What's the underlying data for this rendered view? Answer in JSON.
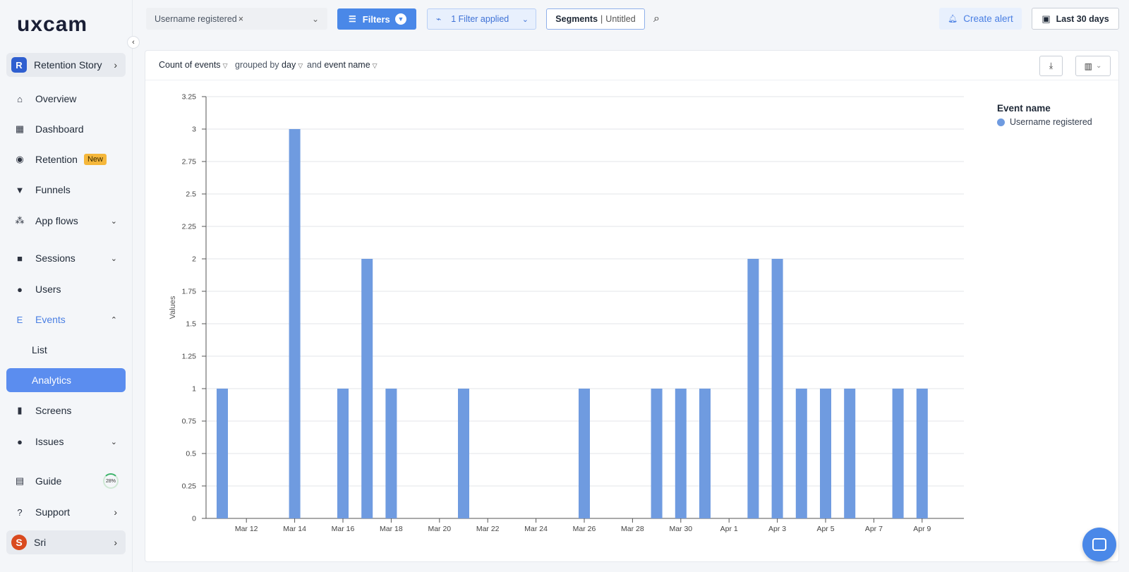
{
  "app": {
    "logo": "uxcam"
  },
  "sidebar": {
    "project": {
      "badge": "R",
      "name": "Retention Story"
    },
    "items": [
      {
        "label": "Overview",
        "icon": "home-icon"
      },
      {
        "label": "Dashboard",
        "icon": "dashboard-icon"
      },
      {
        "label": "Retention",
        "icon": "retention-icon",
        "badge": "New"
      },
      {
        "label": "Funnels",
        "icon": "funnel-icon"
      },
      {
        "label": "App flows",
        "icon": "flows-icon"
      },
      {
        "label": "Sessions",
        "icon": "video-icon"
      },
      {
        "label": "Users",
        "icon": "users-icon"
      },
      {
        "label": "Events",
        "icon": "events-icon"
      },
      {
        "label": "List"
      },
      {
        "label": "Analytics"
      },
      {
        "label": "Screens",
        "icon": "screen-icon"
      },
      {
        "label": "Issues",
        "icon": "alert-icon"
      },
      {
        "label": "Guide",
        "icon": "guide-icon",
        "progress": "28%"
      },
      {
        "label": "Support",
        "icon": "support-icon"
      }
    ],
    "user": {
      "initial": "S",
      "name": "Sri"
    }
  },
  "toolbar": {
    "event_select": "Username registered",
    "filters_label": "Filters",
    "filters_applied": "1 Filter applied",
    "segments_label": "Segments",
    "segments_value": "Untitled",
    "create_alert": "Create alert",
    "date_range": "Last 30 days"
  },
  "query": {
    "metric": "Count of events",
    "grouped_prefix": "grouped by",
    "grouped_value": "day",
    "and_prefix": "and",
    "and_value": "event name"
  },
  "colors": {
    "accent": "#4a88e8",
    "bar": "#6f9be0",
    "active_nav": "#5b8def",
    "new_badge": "#f5b73b"
  },
  "chart_data": {
    "type": "bar",
    "ylabel": "Values",
    "ylim": [
      0,
      3.25
    ],
    "yticks": [
      "0",
      "0.25",
      "0.5",
      "0.75",
      "1",
      "1.25",
      "1.5",
      "1.75",
      "2",
      "2.25",
      "2.5",
      "2.75",
      "3",
      "3.25"
    ],
    "xtick_labels": [
      "Mar 12",
      "Mar 14",
      "Mar 16",
      "Mar 18",
      "Mar 20",
      "Mar 22",
      "Mar 24",
      "Mar 26",
      "Mar 28",
      "Mar 30",
      "Apr 1",
      "Apr 3",
      "Apr 5",
      "Apr 7",
      "Apr 9"
    ],
    "categories": [
      "Mar 11",
      "Mar 12",
      "Mar 13",
      "Mar 14",
      "Mar 15",
      "Mar 16",
      "Mar 17",
      "Mar 18",
      "Mar 19",
      "Mar 20",
      "Mar 21",
      "Mar 22",
      "Mar 23",
      "Mar 24",
      "Mar 25",
      "Mar 26",
      "Mar 27",
      "Mar 28",
      "Mar 29",
      "Mar 30",
      "Mar 31",
      "Apr 1",
      "Apr 2",
      "Apr 3",
      "Apr 4",
      "Apr 5",
      "Apr 6",
      "Apr 7",
      "Apr 8",
      "Apr 9"
    ],
    "legend_title": "Event name",
    "series": [
      {
        "name": "Username registered",
        "values": [
          1,
          0,
          0,
          3,
          0,
          1,
          2,
          1,
          0,
          0,
          1,
          0,
          0,
          0,
          0,
          1,
          0,
          0,
          1,
          1,
          1,
          0,
          2,
          2,
          1,
          1,
          1,
          0,
          1,
          1
        ]
      }
    ],
    "grid": true,
    "legend": "right"
  }
}
